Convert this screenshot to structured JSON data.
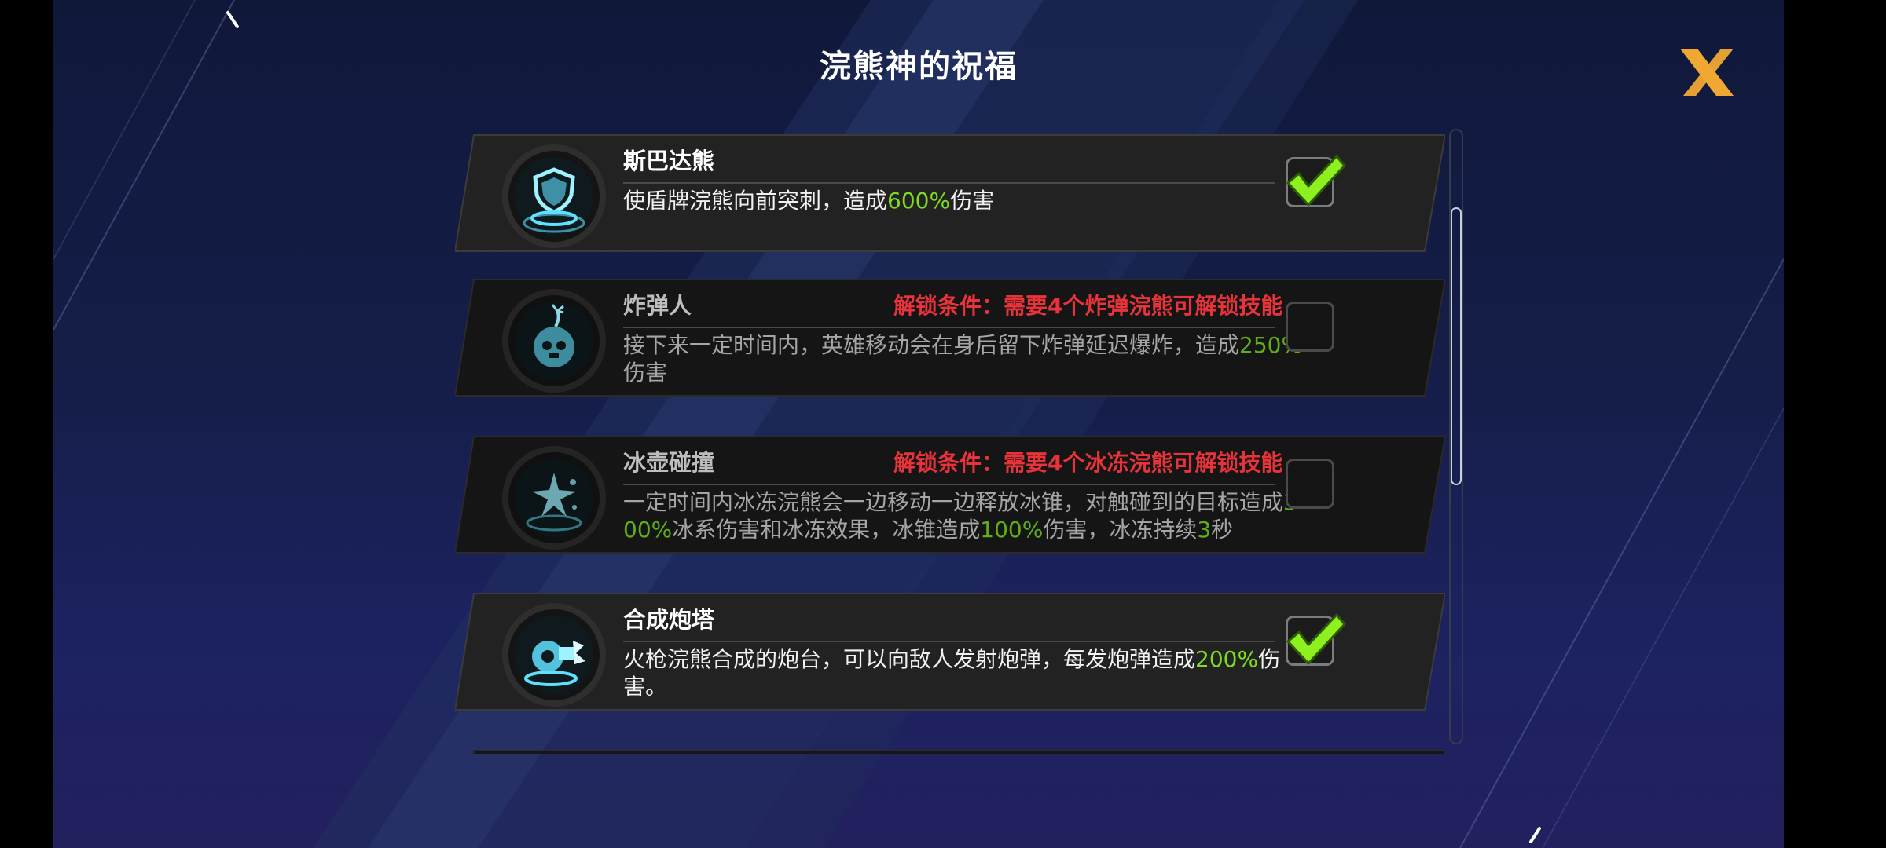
{
  "dialog": {
    "title": "浣熊神的祝福",
    "close_icon": "close-x-icon",
    "accent_color": "#f0a832"
  },
  "skills": [
    {
      "name": "斯巴达熊",
      "icon": "shield-icon",
      "locked": false,
      "checked": true,
      "lock_text": "",
      "desc": [
        {
          "t": "使盾牌浣熊向前突刺，造成",
          "hl": false
        },
        {
          "t": "600%",
          "hl": true
        },
        {
          "t": "伤害",
          "hl": false
        }
      ]
    },
    {
      "name": "炸弹人",
      "icon": "bomb-icon",
      "locked": true,
      "checked": false,
      "lock_text": "解锁条件：需要4个炸弹浣熊可解锁技能",
      "desc": [
        {
          "t": "接下来一定时间内，英雄移动会在身后留下炸弹延迟爆炸，造成",
          "hl": false
        },
        {
          "t": "250%",
          "hl": true
        },
        {
          "t": "伤害",
          "hl": false
        }
      ]
    },
    {
      "name": "冰壶碰撞",
      "icon": "snowflake-icon",
      "locked": true,
      "checked": false,
      "lock_text": "解锁条件：需要4个冰冻浣熊可解锁技能",
      "desc": [
        {
          "t": "一定时间内冰冻浣熊会一边移动一边释放冰锥，对触碰到的目标造成",
          "hl": false
        },
        {
          "t": "300%",
          "hl": true
        },
        {
          "t": "冰系伤害和冰冻效果，冰锥造成",
          "hl": false
        },
        {
          "t": "100%",
          "hl": true
        },
        {
          "t": "伤害，冰冻持续",
          "hl": false
        },
        {
          "t": "3",
          "hl": true
        },
        {
          "t": "秒",
          "hl": false
        }
      ]
    },
    {
      "name": "合成炮塔",
      "icon": "cannon-turret-icon",
      "locked": false,
      "checked": true,
      "lock_text": "",
      "desc": [
        {
          "t": "火枪浣熊合成的炮台，可以向敌人发射炮弹，每发炮弹造成",
          "hl": false
        },
        {
          "t": "200%",
          "hl": true
        },
        {
          "t": "伤害。",
          "hl": false
        }
      ]
    }
  ],
  "colors": {
    "highlight": "#7fdc1f",
    "lock_text": "#e8333a",
    "check": "#8ef01e",
    "glow": "#5fe0ff"
  },
  "scroll": {
    "position_fraction": 0.14,
    "visible_fraction": 0.45
  }
}
